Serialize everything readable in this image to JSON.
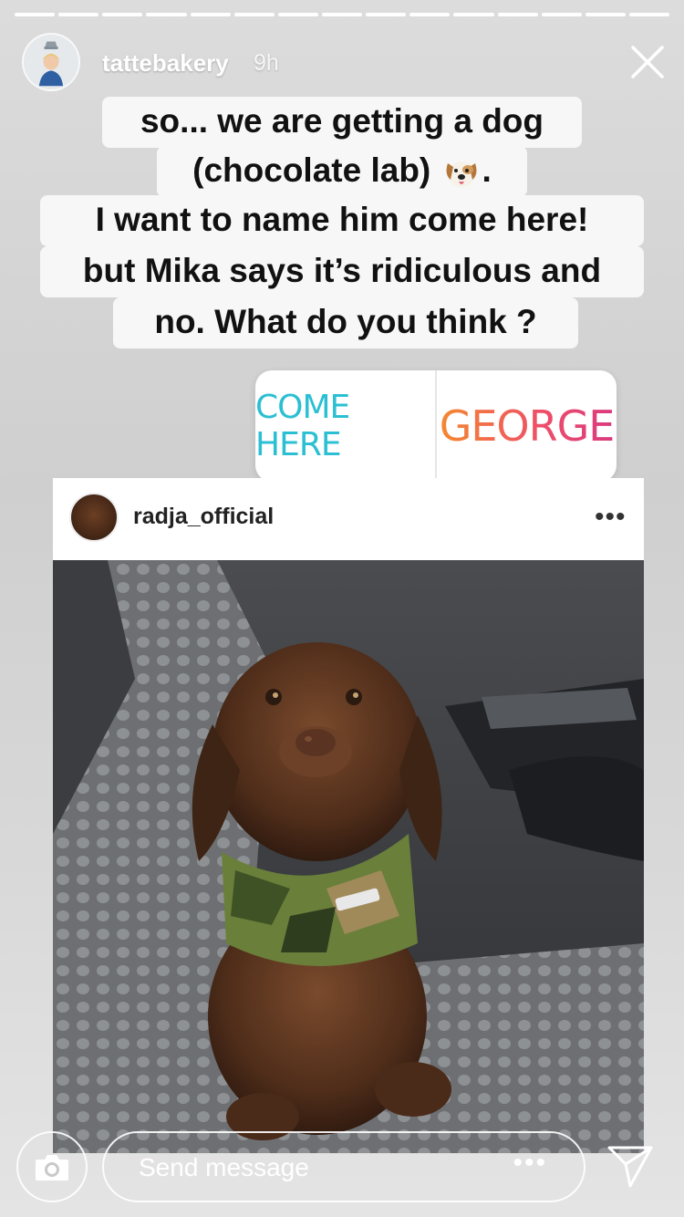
{
  "story": {
    "segments_total": 15,
    "segments_done": 15,
    "username": "tattebakery",
    "time": "9h"
  },
  "caption": {
    "line1": "so... we are getting a dog",
    "line2_text": "(chocolate lab)",
    "line2_end": ".",
    "line3": "I want to name him come here!",
    "line4": "but Mika says it’s ridiculous and",
    "line5": "no.  What do you think ?"
  },
  "poll": {
    "option1": "COME HERE",
    "option2": "GEORGE"
  },
  "post": {
    "username": "radja_official",
    "more": "•••"
  },
  "footer": {
    "message_placeholder": "Send message",
    "dots": "•••"
  },
  "icons": [
    "camera-icon",
    "close-icon",
    "send-icon",
    "dog-emoji-icon"
  ]
}
